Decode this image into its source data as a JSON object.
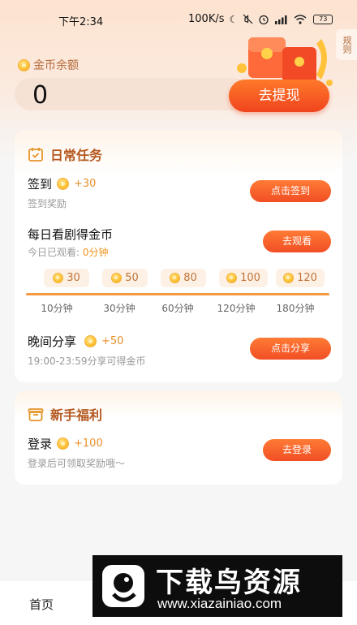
{
  "status_bar": {
    "time": "下午2:34",
    "network_speed": "100K/s",
    "icons": [
      "moon-icon",
      "mute-icon",
      "alarm-icon",
      "signal-icon",
      "wifi-icon"
    ],
    "battery": "73"
  },
  "rule_tab": {
    "label": "规则"
  },
  "balance": {
    "label": "金币余额",
    "value": "0",
    "withdraw_label": "去提现"
  },
  "daily": {
    "title": "日常任务",
    "checkin": {
      "title": "签到",
      "reward": "+30",
      "sub": "签到奖励",
      "button": "点击签到"
    },
    "watch": {
      "title": "每日看剧得金币",
      "sub_prefix": "今日已观看: ",
      "sub_value": "0分钟",
      "button": "去观看",
      "milestones": [
        {
          "coins": "30",
          "time": "10分钟"
        },
        {
          "coins": "50",
          "time": "30分钟"
        },
        {
          "coins": "80",
          "time": "60分钟"
        },
        {
          "coins": "100",
          "time": "120分钟"
        },
        {
          "coins": "120",
          "time": "180分钟"
        }
      ]
    },
    "share": {
      "title": "晚间分享",
      "reward": "+50",
      "sub": "19:00-23:59分享可得金币",
      "button": "点击分享"
    }
  },
  "newbie": {
    "title": "新手福利",
    "login": {
      "title": "登录",
      "reward": "+100",
      "sub": "登录后可领取奖励哦～",
      "button": "去登录"
    }
  },
  "bottom_nav": {
    "home": "首页"
  },
  "watermark": {
    "title": "下载鸟资源",
    "url": "www.xiazainiao.com"
  },
  "colors": {
    "accent": "#f14e24",
    "gold": "#e7902a",
    "title_brown": "#b4581f"
  }
}
